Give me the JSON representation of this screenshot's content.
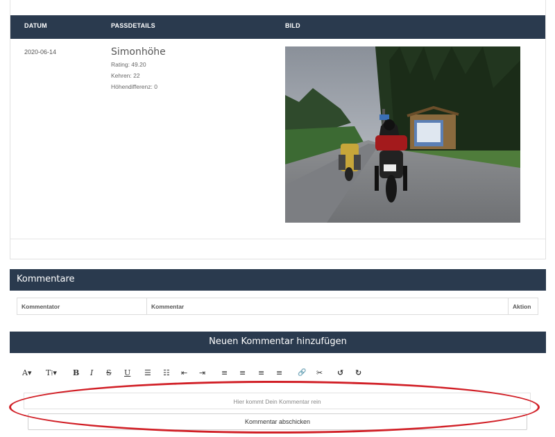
{
  "table": {
    "headers": {
      "datum": "DATUM",
      "passdetails": "PASSDETAILS",
      "bild": "BILD"
    },
    "row": {
      "date": "2020-06-14",
      "pass_name": "Simonhöhe",
      "rating": "Rating: 49.20",
      "kehren": "Kehren: 22",
      "hoehendifferenz": "Höhendifferenz: 0"
    }
  },
  "comments": {
    "title": "Kommentare",
    "columns": [
      "Kommentator",
      "Kommentar",
      "Aktion"
    ]
  },
  "add_comment": {
    "title": "Neuen Kommentar hinzufügen",
    "toolbar": [
      {
        "icon": "font-size-icon",
        "glyph": "A▾"
      },
      {
        "icon": "text-style-icon",
        "glyph": "T⁞▾"
      },
      {
        "icon": "bold-icon",
        "glyph": "B"
      },
      {
        "icon": "italic-icon",
        "glyph": "I"
      },
      {
        "icon": "strikethrough-icon",
        "glyph": "S"
      },
      {
        "icon": "underline-icon",
        "glyph": "U"
      },
      {
        "icon": "bullet-list-icon",
        "glyph": "☰"
      },
      {
        "icon": "numbered-list-icon",
        "glyph": "☷"
      },
      {
        "icon": "outdent-icon",
        "glyph": "⇤"
      },
      {
        "icon": "indent-icon",
        "glyph": "⇥"
      },
      {
        "icon": "align-left-icon",
        "glyph": "≡"
      },
      {
        "icon": "align-center-icon",
        "glyph": "≡"
      },
      {
        "icon": "align-right-icon",
        "glyph": "≡"
      },
      {
        "icon": "align-justify-icon",
        "glyph": "≡"
      },
      {
        "icon": "link-icon",
        "glyph": "🔗"
      },
      {
        "icon": "unlink-icon",
        "glyph": "✂"
      },
      {
        "icon": "undo-icon",
        "glyph": "↺"
      },
      {
        "icon": "redo-icon",
        "glyph": "↻"
      }
    ],
    "placeholder": "Hier kommt Dein Kommentar rein",
    "submit_label": "Kommentar abschicken"
  },
  "colors": {
    "header_bg": "#2a3a4e",
    "annotation_red": "#d11f26"
  }
}
